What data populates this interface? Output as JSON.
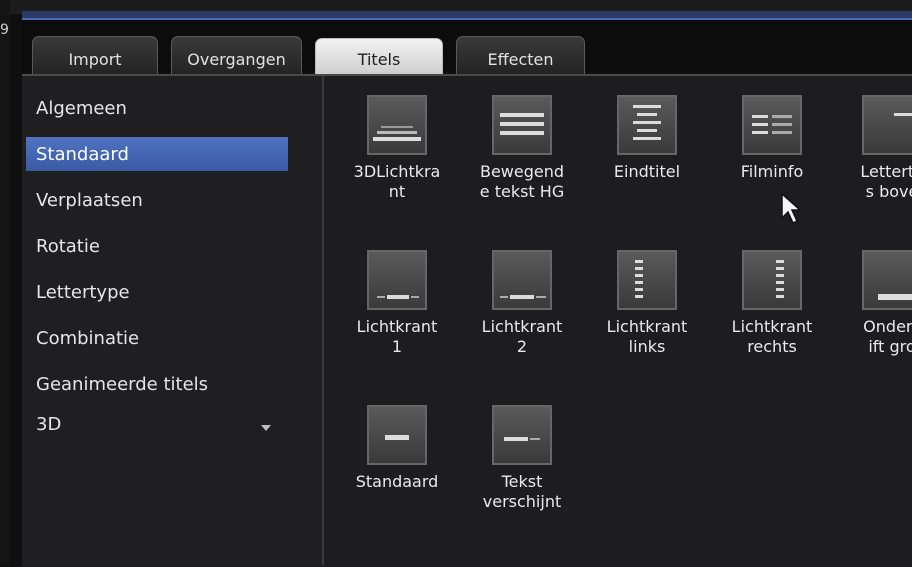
{
  "edge_char": "9",
  "tabs": [
    {
      "label": "Import"
    },
    {
      "label": "Overgangen"
    },
    {
      "label": "Titels"
    },
    {
      "label": "Effecten"
    }
  ],
  "sidebar": {
    "items": [
      {
        "label": "Algemeen"
      },
      {
        "label": "Standaard"
      },
      {
        "label": "Verplaatsen"
      },
      {
        "label": "Rotatie"
      },
      {
        "label": "Lettertype"
      },
      {
        "label": "Combinatie"
      },
      {
        "label": "Geanimeerde titels"
      },
      {
        "label": "3D"
      }
    ],
    "selected": "Standaard",
    "expand_icon": "chevron-down-icon"
  },
  "templates": [
    {
      "label": "3DLichtkra\nnt",
      "icon": "perspective-lines-icon"
    },
    {
      "label": "Bewegend\ne tekst HG",
      "icon": "text-lines-icon"
    },
    {
      "label": "Eindtitel",
      "icon": "credits-icon"
    },
    {
      "label": "Filminfo",
      "icon": "info-lines-icon"
    },
    {
      "label": "Letterty\ns bove",
      "icon": "top-text-icon"
    },
    {
      "label": "Lichtkrant\n1",
      "icon": "ticker-bottom-icon"
    },
    {
      "label": "Lichtkrant\n2",
      "icon": "ticker-bottom-icon"
    },
    {
      "label": "Lichtkrant\nlinks",
      "icon": "ticker-left-icon"
    },
    {
      "label": "Lichtkrant\nrechts",
      "icon": "ticker-right-icon"
    },
    {
      "label": "Onders\nift gro",
      "icon": "subtitle-large-icon"
    },
    {
      "label": "Standaard",
      "icon": "subtitle-icon"
    },
    {
      "label": "Tekst\nverschijnt",
      "icon": "text-appear-icon"
    }
  ],
  "colors": {
    "accent": "#3a5aa4",
    "selected_tab": "#e8e8e8",
    "panel": "#1d1d1f"
  }
}
